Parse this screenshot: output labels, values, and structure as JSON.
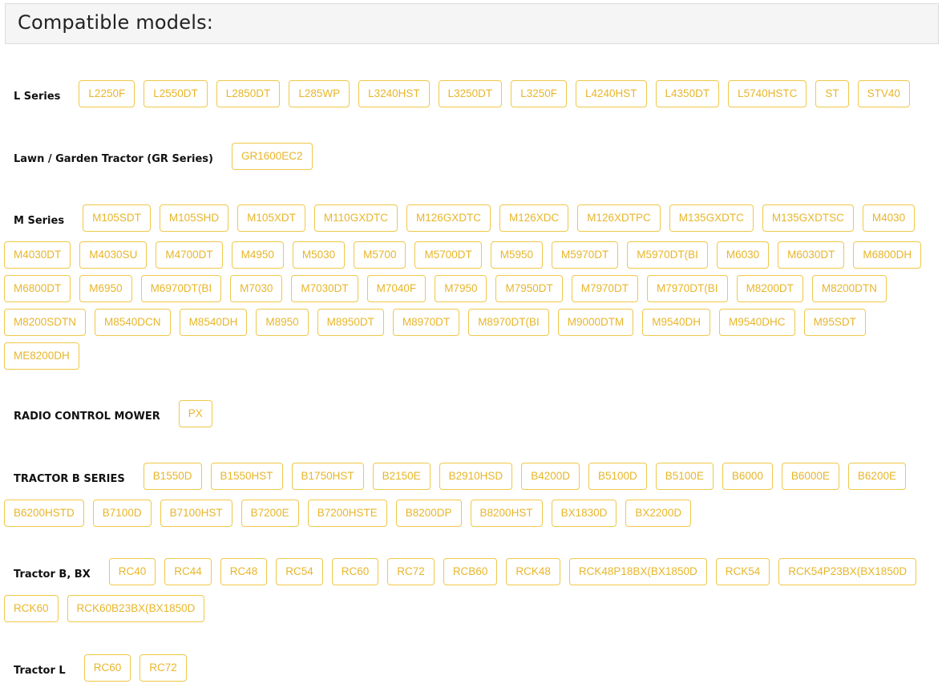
{
  "header": {
    "title": "Compatible models:"
  },
  "groups": [
    {
      "label": "L Series",
      "models": [
        "L2250F",
        "L2550DT",
        "L2850DT",
        "L285WP",
        "L3240HST",
        "L3250DT",
        "L3250F",
        "L4240HST",
        "L4350DT",
        "L5740HSTC",
        "ST",
        "STV40"
      ]
    },
    {
      "label": "Lawn / Garden Tractor (GR Series)",
      "models": [
        "GR1600EC2"
      ]
    },
    {
      "label": "M Series",
      "models": [
        "M105SDT",
        "M105SHD",
        "M105XDT",
        "M110GXDTC",
        "M126GXDTC",
        "M126XDC",
        "M126XDTPC",
        "M135GXDTC",
        "M135GXDTSC",
        "M4030",
        "M4030DT",
        "M4030SU",
        "M4700DT",
        "M4950",
        "M5030",
        "M5700",
        "M5700DT",
        "M5950",
        "M5970DT",
        "M5970DT(BI",
        "M6030",
        "M6030DT",
        "M6800DH",
        "M6800DT",
        "M6950",
        "M6970DT(BI",
        "M7030",
        "M7030DT",
        "M7040F",
        "M7950",
        "M7950DT",
        "M7970DT",
        "M7970DT(BI",
        "M8200DT",
        "M8200DTN",
        "M8200SDTN",
        "M8540DCN",
        "M8540DH",
        "M8950",
        "M8950DT",
        "M8970DT",
        "M8970DT(BI",
        "M9000DTM",
        "M9540DH",
        "M9540DHC",
        "M95SDT",
        "ME8200DH"
      ]
    },
    {
      "label": "RADIO CONTROL MOWER",
      "models": [
        "PX"
      ]
    },
    {
      "label": "TRACTOR B SERIES",
      "models": [
        "B1550D",
        "B1550HST",
        "B1750HST",
        "B2150E",
        "B2910HSD",
        "B4200D",
        "B5100D",
        "B5100E",
        "B6000",
        "B6000E",
        "B6200E",
        "B6200HSTD",
        "B7100D",
        "B7100HST",
        "B7200E",
        "B7200HSTE",
        "B8200DP",
        "B8200HST",
        "BX1830D",
        "BX2200D"
      ]
    },
    {
      "label": "Tractor B, BX",
      "models": [
        "RC40",
        "RC44",
        "RC48",
        "RC54",
        "RC60",
        "RC72",
        "RCB60",
        "RCK48",
        "RCK48P18BX(BX1850D",
        "RCK54",
        "RCK54P23BX(BX1850D",
        "RCK60",
        "RCK60B23BX(BX1850D"
      ]
    },
    {
      "label": "Tractor L",
      "models": [
        "RC60",
        "RC72"
      ]
    }
  ],
  "colors": {
    "chip_border": "#f0c848",
    "chip_text": "#e8b62a",
    "header_bg": "#f5f5f5"
  }
}
